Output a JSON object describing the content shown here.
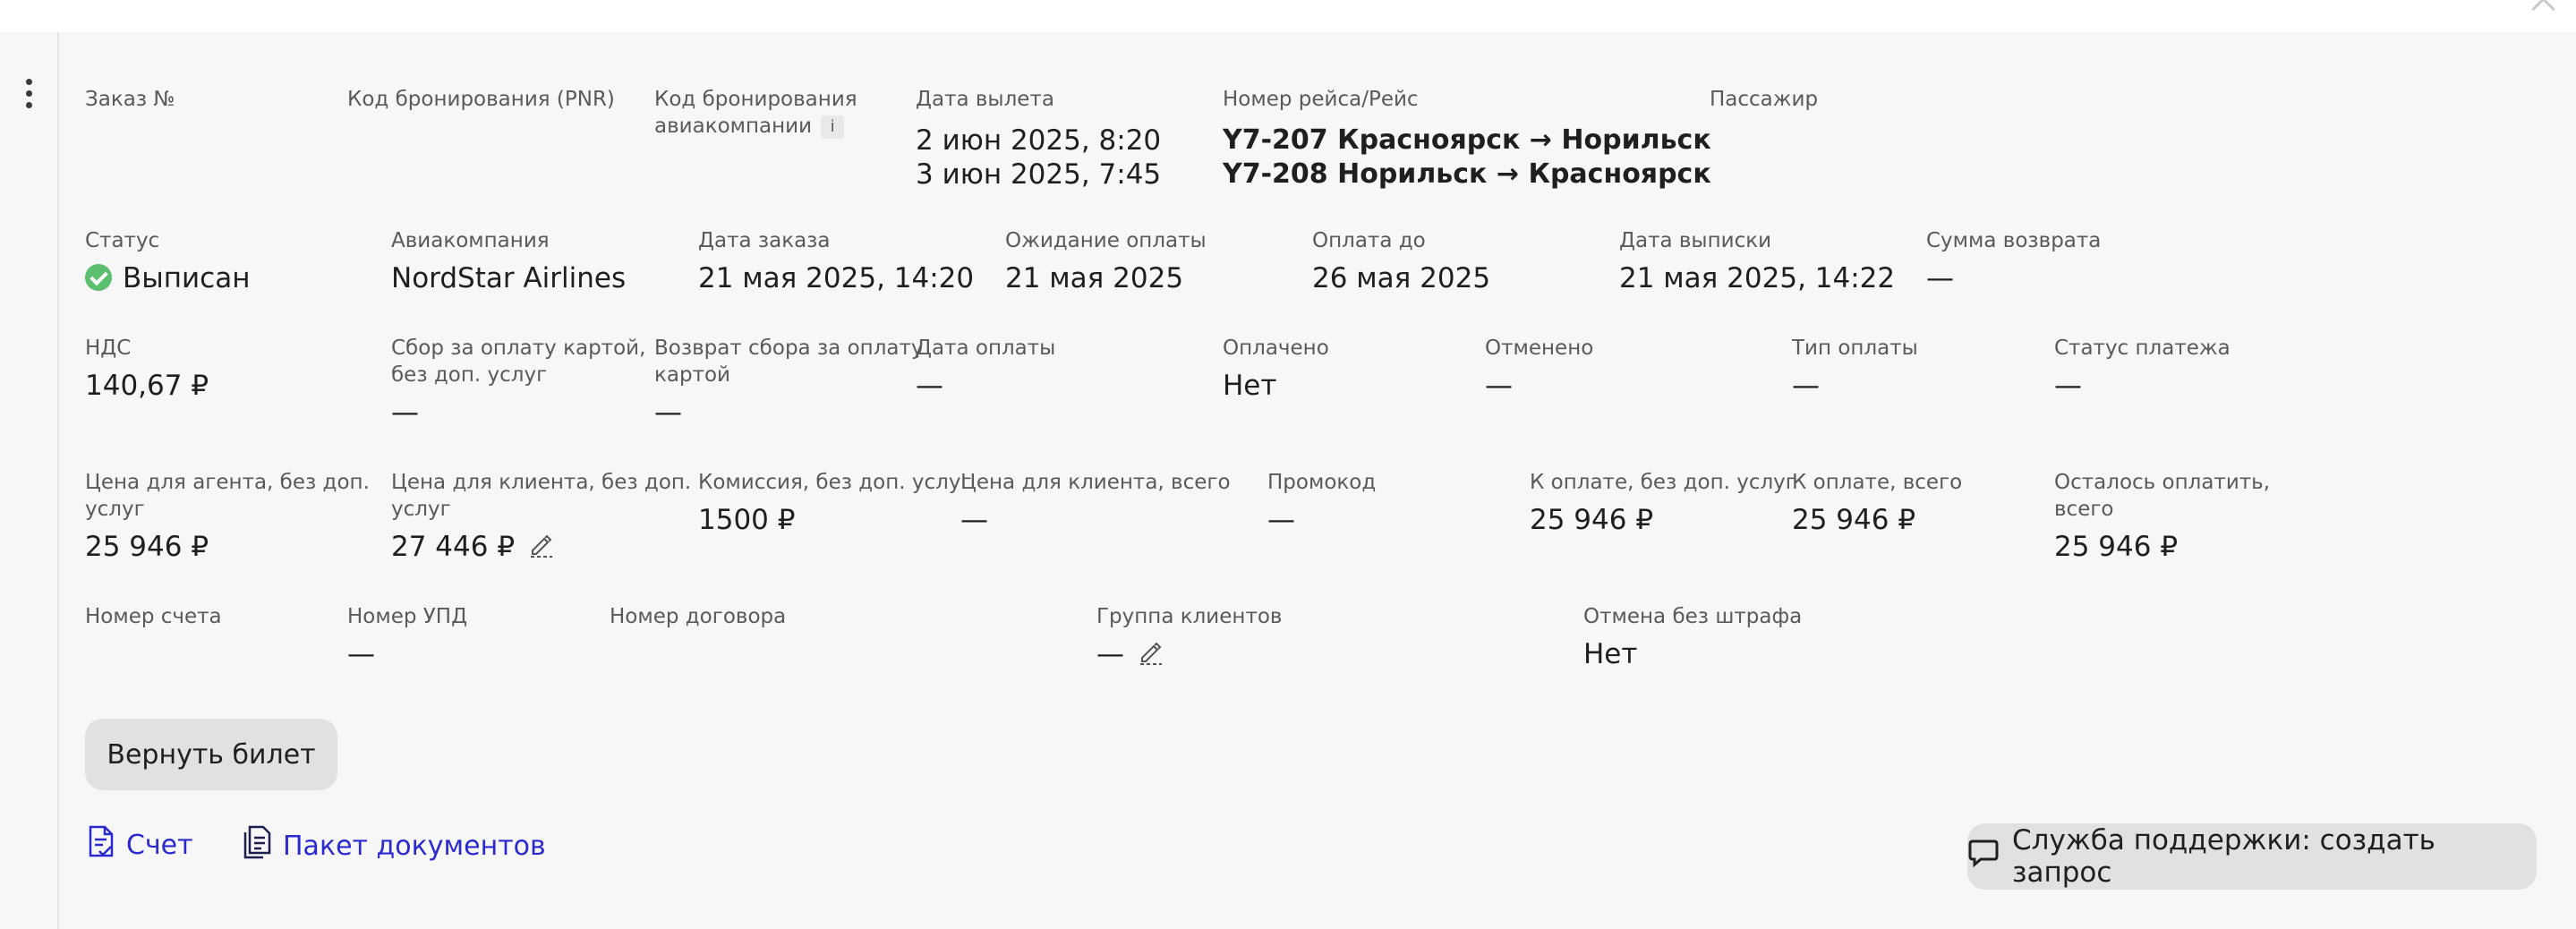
{
  "header": {
    "menu_icon": "kebab-menu-icon",
    "close_icon": "close-icon"
  },
  "row1": {
    "order_no": {
      "label": "Заказ №",
      "value": ""
    },
    "pnr": {
      "label": "Код бронирования (PNR)",
      "value": ""
    },
    "airline_code": {
      "label_line1": "Код бронирования",
      "label_line2": "авиакомпании",
      "info": "i"
    },
    "departure_date": {
      "label": "Дата вылета",
      "line1": "2 июн 2025, 8:20",
      "line2": "3 июн 2025, 7:45"
    },
    "flight": {
      "label": "Номер рейса/Рейс",
      "line1": "Y7-207 Красноярск → Норильск",
      "line2": "Y7-208 Норильск → Красноярск"
    },
    "passenger": {
      "label": "Пассажир",
      "value": ""
    }
  },
  "row2": {
    "status": {
      "label": "Статус",
      "value": "Выписан",
      "color": "#5bbf6d"
    },
    "airline": {
      "label": "Авиакомпания",
      "value": "NordStar Airlines"
    },
    "order_date": {
      "label": "Дата заказа",
      "value": "21 мая 2025, 14:20"
    },
    "awaiting_payment": {
      "label": "Ожидание оплаты",
      "value": "21 мая 2025"
    },
    "pay_until": {
      "label": "Оплата до",
      "value": "26 мая 2025"
    },
    "issue_date": {
      "label": "Дата выписки",
      "value": "21 мая 2025, 14:22"
    },
    "refund_sum": {
      "label": "Сумма возврата",
      "value": "—"
    }
  },
  "row3": {
    "vat": {
      "label": "НДС",
      "value": "140,67 ₽"
    },
    "card_fee": {
      "label_line1": "Сбор за оплату картой,",
      "label_line2": "без доп. услуг",
      "value": "—"
    },
    "card_fee_refund": {
      "label_line1": "Возврат сбора за оплату",
      "label_line2": "картой",
      "value": "—"
    },
    "payment_date": {
      "label": "Дата оплаты",
      "value": "—"
    },
    "paid": {
      "label": "Оплачено",
      "value": "Нет"
    },
    "cancelled": {
      "label": "Отменено",
      "value": "—"
    },
    "payment_type": {
      "label": "Тип оплаты",
      "value": "—"
    },
    "payment_status": {
      "label": "Статус платежа",
      "value": "—"
    }
  },
  "row4": {
    "agent_price": {
      "label_line1": "Цена для агента, без доп.",
      "label_line2": "услуг",
      "value": "25 946 ₽"
    },
    "client_price": {
      "label_line1": "Цена для клиента, без доп.",
      "label_line2": "услуг",
      "value": "27 446 ₽"
    },
    "commission": {
      "label": "Комиссия, без доп. услуг",
      "value": "1500 ₽"
    },
    "client_price_total": {
      "label": "Цена для клиента, всего",
      "value": "—"
    },
    "promo": {
      "label": "Промокод",
      "value": "—"
    },
    "to_pay": {
      "label": "К оплате, без доп. услуг",
      "value": "25 946 ₽"
    },
    "to_pay_total": {
      "label": "К оплате, всего",
      "value": "25 946 ₽"
    },
    "remaining": {
      "label_line1": "Осталось оплатить,",
      "label_line2": "всего",
      "value": "25 946 ₽"
    }
  },
  "row5": {
    "invoice_no": {
      "label": "Номер счета",
      "value": ""
    },
    "upd_no": {
      "label": "Номер УПД",
      "value": "—"
    },
    "contract_no": {
      "label": "Номер договора",
      "value": ""
    },
    "client_group": {
      "label": "Группа клиентов",
      "value": "—"
    },
    "free_cancel": {
      "label": "Отмена без штрафа",
      "value": "Нет"
    }
  },
  "actions": {
    "return_ticket": "Вернуть билет",
    "invoice_link": "Счет",
    "documents_link": "Пакет документов",
    "support": "Служба поддержки: создать запрос",
    "link_color": "#2a2ad0"
  }
}
